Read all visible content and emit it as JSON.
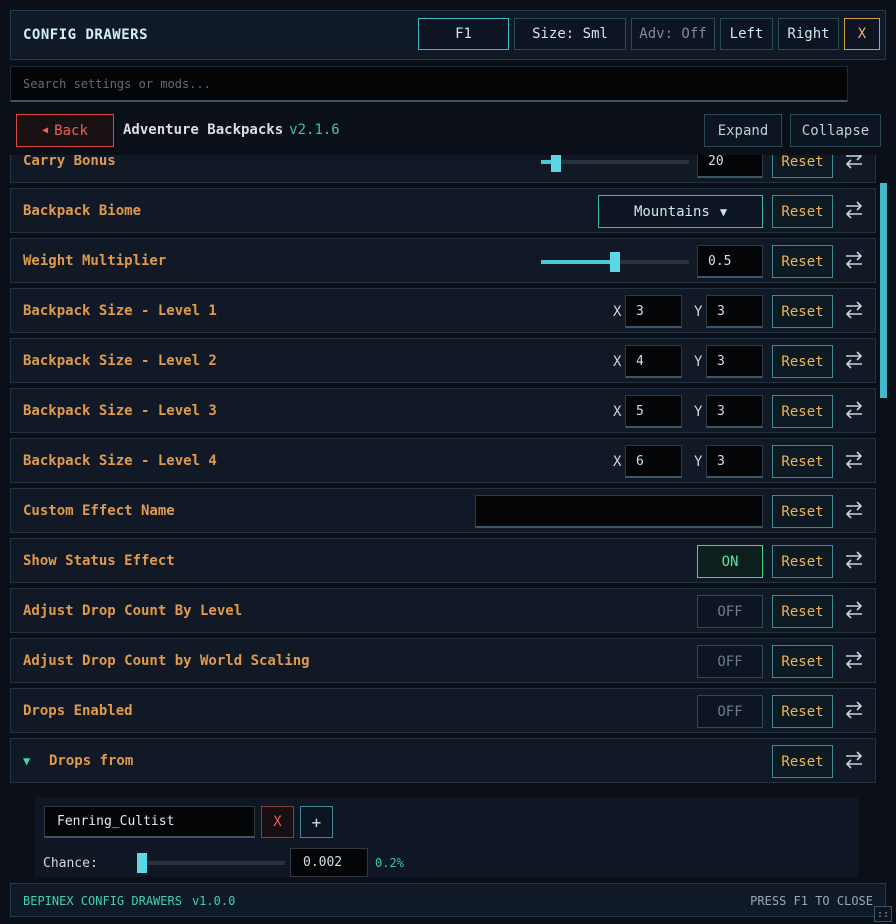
{
  "header": {
    "title": "CONFIG DRAWERS",
    "buttons": {
      "hotkey": "F1",
      "size": "Size: Sml",
      "adv": "Adv: Off",
      "left": "Left",
      "right": "Right",
      "close": "X"
    }
  },
  "search": {
    "placeholder": "Search settings or mods..."
  },
  "mod": {
    "back": "Back",
    "name": "Adventure Backpacks",
    "version": "v2.1.6",
    "expand": "Expand",
    "collapse": "Collapse"
  },
  "reset_label": "Reset",
  "rows": {
    "carry_bonus": {
      "label": "Carry Bonus",
      "value": "20",
      "fill_fraction": 0.1
    },
    "backpack_biome": {
      "label": "Backpack Biome",
      "value": "Mountains"
    },
    "weight_multiplier": {
      "label": "Weight Multiplier",
      "value": "0.5",
      "fill_fraction": 0.5
    },
    "size_level_1": {
      "label": "Backpack Size - Level 1",
      "x_label": "X",
      "x": "3",
      "y_label": "Y",
      "y": "3"
    },
    "size_level_2": {
      "label": "Backpack Size - Level 2",
      "x_label": "X",
      "x": "4",
      "y_label": "Y",
      "y": "3"
    },
    "size_level_3": {
      "label": "Backpack Size - Level 3",
      "x_label": "X",
      "x": "5",
      "y_label": "Y",
      "y": "3"
    },
    "size_level_4": {
      "label": "Backpack Size - Level 4",
      "x_label": "X",
      "x": "6",
      "y_label": "Y",
      "y": "3"
    },
    "custom_effect_name": {
      "label": "Custom Effect Name",
      "value": ""
    },
    "show_status_effect": {
      "label": "Show Status Effect",
      "value": "ON"
    },
    "adjust_drop_level": {
      "label": "Adjust Drop Count By Level",
      "value": "OFF"
    },
    "adjust_drop_world": {
      "label": "Adjust Drop Count by World Scaling",
      "value": "OFF"
    },
    "drops_enabled": {
      "label": "Drops Enabled",
      "value": "OFF"
    },
    "drops_from": {
      "label": "Drops from"
    }
  },
  "drop_entry": {
    "creature": "Fenring_Cultist",
    "remove": "X",
    "add": "+",
    "chance_label": "Chance:",
    "chance_value": "0.002",
    "chance_percent": "0.2%"
  },
  "footer": {
    "left": "BEPINEX CONFIG DRAWERS",
    "version": "v1.0.0",
    "right": "PRESS F1 TO CLOSE"
  },
  "colors": {
    "accent": "#48c9d6",
    "label": "#e09a4a",
    "reset": "#f0b450",
    "on": "#5fe39a",
    "danger": "#e85f55"
  }
}
